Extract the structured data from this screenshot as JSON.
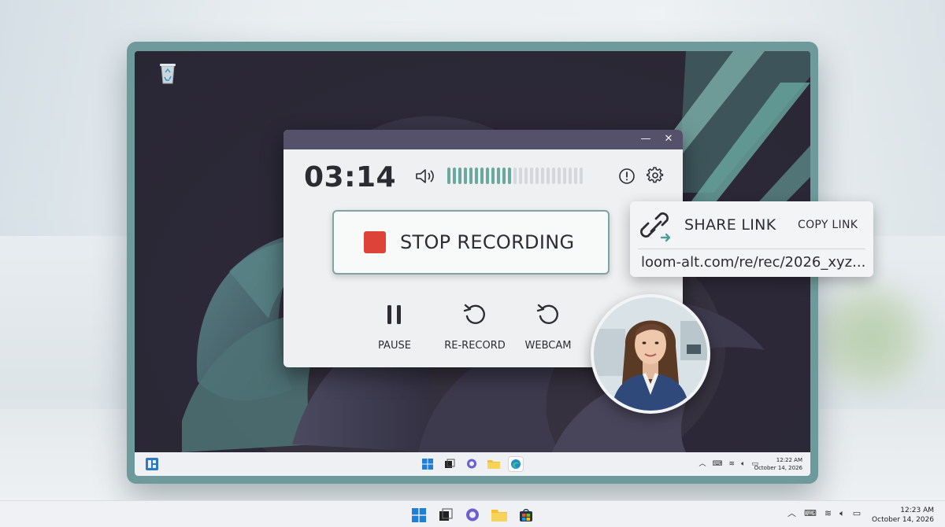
{
  "recorder": {
    "timer": "03:14",
    "minimize_label": "—",
    "close_label": "✕",
    "stop_label": "STOP RECORDING",
    "audio_level": 0.47,
    "controls": {
      "pause": "PAUSE",
      "rerecord": "RE-RECORD",
      "webcam": "WEBCAM"
    },
    "colors": {
      "accent": "#6aa8a0",
      "stop": "#dd4437",
      "titlebar": "#55516a"
    }
  },
  "share": {
    "title": "SHARE LINK",
    "copy_label": "COPY LINK",
    "url": "loom-alt.com/re/rec/2026_xyz..."
  },
  "desktop": {
    "taskbar_apps": [
      "windows-start-icon",
      "task-view-icon",
      "chat-icon",
      "file-explorer-icon",
      "edge-icon"
    ],
    "clock": {
      "time": "12:22 AM",
      "date": "October 14, 2026"
    }
  },
  "host_taskbar": {
    "apps": [
      "windows-start-icon",
      "task-view-icon",
      "chat-icon",
      "file-explorer-icon",
      "store-icon"
    ],
    "clock": {
      "time": "12:23 AM",
      "date": "October 14, 2026"
    }
  }
}
